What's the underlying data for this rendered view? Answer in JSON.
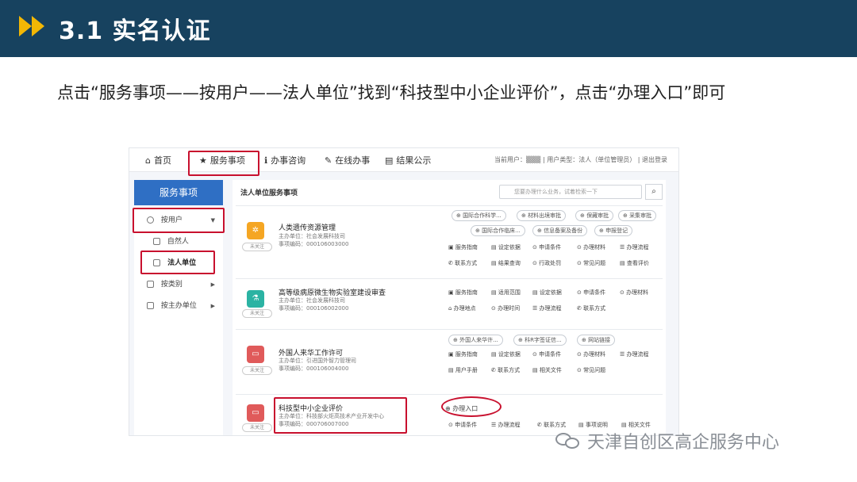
{
  "slide": {
    "title": "3.1 实名认证",
    "instruction": "点击“服务事项——按用户——法人单位”找到“科技型中小企业评价”，点击“办理入口”即可"
  },
  "nav": {
    "items": [
      "首页",
      "服务事项",
      "办事咨询",
      "在线办事",
      "结果公示"
    ],
    "user_info": "当前用户：▒▒▒ | 用户类型：法人（单位管理员） | 退出登录"
  },
  "sidebar": {
    "header": "服务事项",
    "items": [
      {
        "label": "按用户"
      },
      {
        "label": "自然人"
      },
      {
        "label": "法人单位"
      },
      {
        "label": "按类别"
      },
      {
        "label": "按主办单位"
      }
    ]
  },
  "main": {
    "title": "法人单位服务事项",
    "search_placeholder": "您要办理什么业务，试着检索一下"
  },
  "services": [
    {
      "name": "人类遗传资源管理",
      "unit": "主办单位：社会发展科技司",
      "code": "事项编码：000106003000",
      "follow": "未关注",
      "pills": [
        "国际合作科学...",
        "材料出境审批",
        "保藏审批",
        "采集审批",
        "国际合作临床...",
        "信息备案及备份",
        "申报登记"
      ],
      "links": [
        "服务指南",
        "设定依据",
        "申请条件",
        "办理材料",
        "办理流程",
        "联系方式",
        "结果查询",
        "行政处罚",
        "常见问题",
        "查看评价"
      ]
    },
    {
      "name": "高等级病原微生物实验室建设审查",
      "unit": "主办单位：社会发展科技司",
      "code": "事项编码：000106002000",
      "follow": "未关注",
      "links": [
        "服务指南",
        "适用范围",
        "设定依据",
        "申请条件",
        "办理材料",
        "办理地点",
        "办理时间",
        "办理流程",
        "联系方式"
      ]
    },
    {
      "name": "外国人来华工作许可",
      "unit": "主办单位：引进国外智力管理司",
      "code": "事项编码：000106004000",
      "follow": "未关注",
      "pills": [
        "外国人来华许...",
        "科R字签证信...",
        "网站链接"
      ],
      "links": [
        "服务指南",
        "设定依据",
        "申请条件",
        "办理材料",
        "办理流程",
        "用户手册",
        "联系方式",
        "相关文件",
        "常见问题"
      ]
    },
    {
      "name": "科技型中小企业评价",
      "unit": "主办单位：科技部火炬高技术产业开发中心",
      "code": "事项编码：000706007000",
      "follow": "未关注",
      "pills": [
        "办理入口"
      ],
      "links": [
        "申请条件",
        "办理流程",
        "联系方式",
        "事项说明",
        "相关文件"
      ]
    }
  ],
  "watermark": "天津自创区高企服务中心",
  "colors": {
    "header_bg": "#17425f",
    "chevron": "#f2b705",
    "sidebar_header": "#2f6fc4",
    "highlight": "#c8102e",
    "icon_orange": "#f5a623",
    "icon_teal": "#2bb3a3",
    "icon_red": "#e05a5a"
  }
}
